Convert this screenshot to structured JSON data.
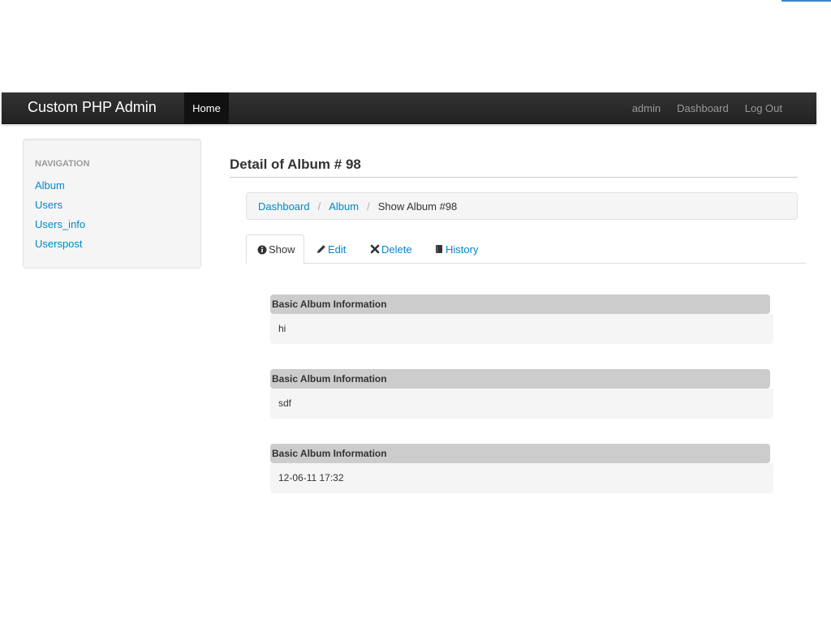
{
  "navbar": {
    "brand": "Custom PHP Admin",
    "home": "Home",
    "right_links": [
      "admin",
      "Dashboard",
      "Log Out"
    ]
  },
  "sidebar": {
    "header": "NAVIGATION",
    "items": [
      "Album",
      "Users",
      "Users_info",
      "Userspost"
    ]
  },
  "page": {
    "title": "Detail of Album # 98"
  },
  "breadcrumb": {
    "items": [
      "Dashboard",
      "Album"
    ],
    "current": "Show Album #98",
    "separator": "/"
  },
  "tabs": [
    {
      "label": "Show",
      "icon": "info-circle-icon",
      "active": true
    },
    {
      "label": "Edit",
      "icon": "pencil-icon",
      "active": false
    },
    {
      "label": "Delete",
      "icon": "remove-x-icon",
      "active": false
    },
    {
      "label": "History",
      "icon": "book-icon",
      "active": false
    }
  ],
  "sections": [
    {
      "heading": "Basic Album Information",
      "value": "hi"
    },
    {
      "heading": "Basic Album Information",
      "value": "sdf"
    },
    {
      "heading": "Basic Album Information",
      "value": "12-06-11 17:32"
    }
  ],
  "colors": {
    "navbar_bg": "#222222",
    "link": "#0088cc",
    "section_head_bg": "#cccccc",
    "section_body_bg": "#f5f5f5"
  }
}
